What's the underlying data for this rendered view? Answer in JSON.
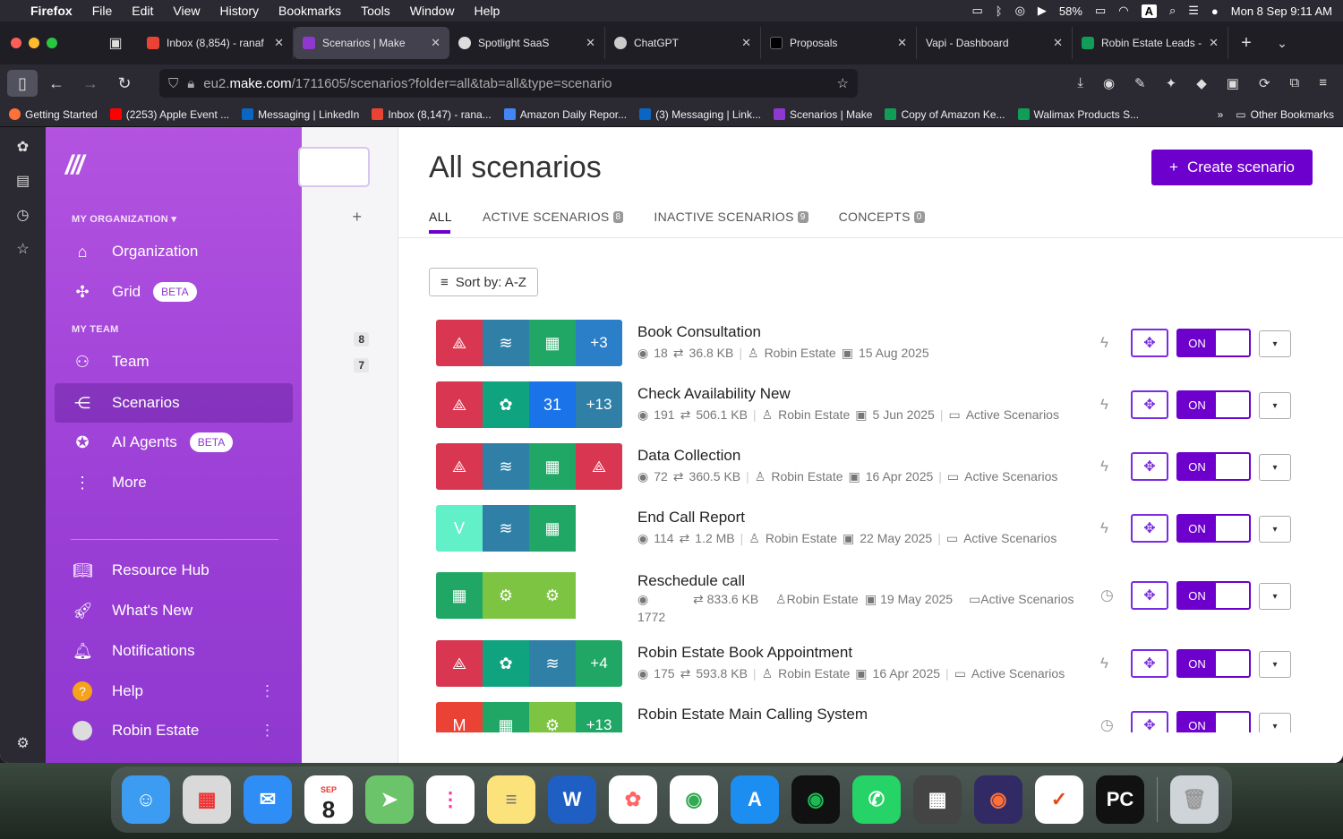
{
  "menubar": {
    "app": "Firefox",
    "items": [
      "File",
      "Edit",
      "View",
      "History",
      "Bookmarks",
      "Tools",
      "Window",
      "Help"
    ],
    "battery": "58%",
    "input_source": "A",
    "datetime": "Mon 8 Sep  9:11 AM"
  },
  "tabs": [
    {
      "title": "Inbox (8,854) - ranaf",
      "color": "#ea4335"
    },
    {
      "title": "Scenarios | Make",
      "color": "#8f38d0",
      "active": true
    },
    {
      "title": "Spotlight SaaS",
      "color": "#dddddd"
    },
    {
      "title": "ChatGPT",
      "color": "#cccccc"
    },
    {
      "title": "Proposals",
      "color": "#000000"
    },
    {
      "title": "Vapi - Dashboard",
      "color": "#1f1e25"
    },
    {
      "title": "Robin Estate Leads -",
      "color": "#0f9d58"
    }
  ],
  "url": {
    "prefix": "eu2.",
    "domain": "make.com",
    "path": "/1711605/scenarios?folder=all&tab=all&type=scenario"
  },
  "bookmarks": [
    {
      "label": "Getting Started",
      "color": "#ff7139"
    },
    {
      "label": "(2253) Apple Event ...",
      "color": "#ff0000"
    },
    {
      "label": "Messaging | LinkedIn",
      "color": "#0a66c2"
    },
    {
      "label": "Inbox (8,147) - rana...",
      "color": "#ea4335"
    },
    {
      "label": "Amazon Daily Repor...",
      "color": "#4285f4"
    },
    {
      "label": "(3) Messaging | Link...",
      "color": "#0a66c2"
    },
    {
      "label": "Scenarios | Make",
      "color": "#8f38d0"
    },
    {
      "label": "Copy of Amazon Ke...",
      "color": "#0f9d58"
    },
    {
      "label": "Walimax Products S...",
      "color": "#0f9d58"
    }
  ],
  "other_bookmarks": "Other Bookmarks",
  "sidebar": {
    "org_label": "MY ORGANIZATION",
    "team_label": "MY TEAM",
    "items": {
      "organization": "Organization",
      "grid": "Grid",
      "grid_badge": "BETA",
      "team": "Team",
      "scenarios": "Scenarios",
      "ai_agents": "AI Agents",
      "ai_badge": "BETA",
      "more": "More",
      "resource_hub": "Resource Hub",
      "whats_new": "What's New",
      "notifications": "Notifications",
      "help": "Help",
      "user": "Robin Estate"
    }
  },
  "folder_counts": [
    "8",
    "7"
  ],
  "main": {
    "title": "All scenarios",
    "create_label": "Create scenario",
    "tabs": [
      {
        "label": "ALL",
        "count": ""
      },
      {
        "label": "ACTIVE SCENARIOS",
        "count": "8"
      },
      {
        "label": "INACTIVE SCENARIOS",
        "count": "9"
      },
      {
        "label": "CONCEPTS",
        "count": "0"
      }
    ],
    "sort_label": "Sort by: A-Z",
    "toggle_label": "ON"
  },
  "scenarios": [
    {
      "name": "Book Consultation",
      "views": "18",
      "size": "36.8 KB",
      "owner": "Robin Estate",
      "date": "15 Aug 2025",
      "folder": "",
      "more": "+3"
    },
    {
      "name": "Check Availability New",
      "views": "191",
      "size": "506.1 KB",
      "owner": "Robin Estate",
      "date": "5 Jun 2025",
      "folder": "Active Scenarios",
      "more": "+13"
    },
    {
      "name": "Data Collection",
      "views": "72",
      "size": "360.5 KB",
      "owner": "Robin Estate",
      "date": "16 Apr 2025",
      "folder": "Active Scenarios",
      "more": ""
    },
    {
      "name": "End Call Report",
      "views": "114",
      "size": "1.2 MB",
      "owner": "Robin Estate",
      "date": "22 May 2025",
      "folder": "Active Scenarios",
      "more": ""
    },
    {
      "name": "Reschedule call",
      "views": "1772",
      "size": "833.6 KB",
      "owner": "Robin Estate",
      "date": "19 May 2025",
      "folder": "Active Scenarios",
      "more": ""
    },
    {
      "name": "Robin Estate Book Appointment",
      "views": "175",
      "size": "593.8 KB",
      "owner": "Robin Estate",
      "date": "16 Apr 2025",
      "folder": "Active Scenarios",
      "more": "+4"
    },
    {
      "name": "Robin Estate Main Calling System",
      "views": "",
      "size": "",
      "owner": "",
      "date": "",
      "folder": "",
      "more": "+13"
    }
  ],
  "dock": {
    "calendar_month": "SEP",
    "calendar_day": "8"
  }
}
